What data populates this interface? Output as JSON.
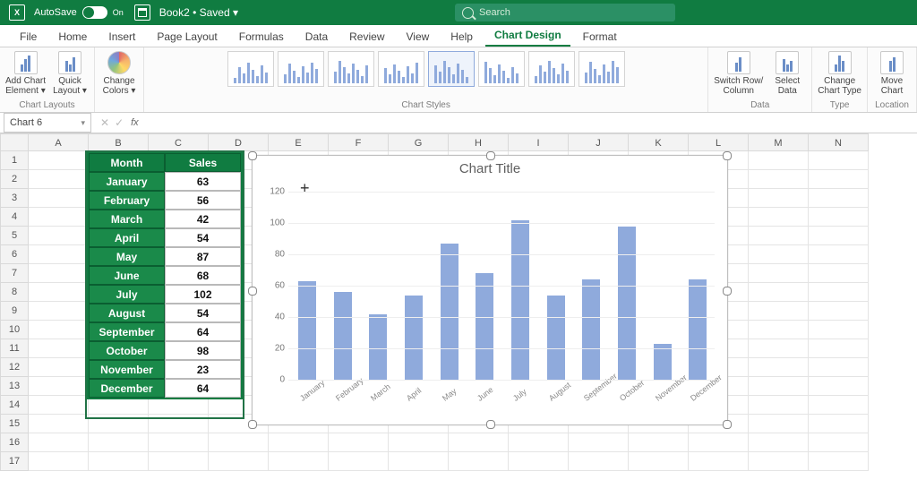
{
  "titlebar": {
    "autosave_label": "AutoSave",
    "autosave_state": "On",
    "doc_name": "Book2",
    "doc_status": "Saved",
    "search_placeholder": "Search"
  },
  "tabs": [
    "File",
    "Home",
    "Insert",
    "Page Layout",
    "Formulas",
    "Data",
    "Review",
    "View",
    "Help",
    "Chart Design",
    "Format"
  ],
  "active_tab": "Chart Design",
  "ribbon": {
    "layouts": {
      "add_chart": "Add Chart\nElement ▾",
      "quick": "Quick\nLayout ▾",
      "label": "Chart Layouts"
    },
    "colors": {
      "change": "Change\nColors ▾"
    },
    "styles_label": "Chart Styles",
    "data": {
      "switch": "Switch Row/\nColumn",
      "select": "Select\nData",
      "label": "Data"
    },
    "type": {
      "change": "Change\nChart Type",
      "label": "Type"
    },
    "location": {
      "move": "Move\nChart",
      "label": "Location"
    }
  },
  "namebox": "Chart 6",
  "fx_label": "fx",
  "columns": [
    "A",
    "B",
    "C",
    "D",
    "E",
    "F",
    "G",
    "H",
    "I",
    "J",
    "K",
    "L",
    "M",
    "N"
  ],
  "row_count": 17,
  "table": {
    "headers": [
      "Month",
      "Sales"
    ],
    "rows": [
      [
        "January",
        "63"
      ],
      [
        "February",
        "56"
      ],
      [
        "March",
        "42"
      ],
      [
        "April",
        "54"
      ],
      [
        "May",
        "87"
      ],
      [
        "June",
        "68"
      ],
      [
        "July",
        "102"
      ],
      [
        "August",
        "54"
      ],
      [
        "September",
        "64"
      ],
      [
        "October",
        "98"
      ],
      [
        "November",
        "23"
      ],
      [
        "December",
        "64"
      ]
    ]
  },
  "chart_data": {
    "type": "bar",
    "title": "Chart Title",
    "categories": [
      "January",
      "February",
      "March",
      "April",
      "May",
      "June",
      "July",
      "August",
      "September",
      "October",
      "November",
      "December"
    ],
    "values": [
      63,
      56,
      42,
      54,
      87,
      68,
      102,
      54,
      64,
      98,
      23,
      64
    ],
    "ylim": [
      0,
      120
    ],
    "yticks": [
      0,
      20,
      40,
      60,
      80,
      100,
      120
    ],
    "xlabel": "",
    "ylabel": ""
  },
  "colors": {
    "brand": "#107c41",
    "bar": "#8faadc"
  }
}
